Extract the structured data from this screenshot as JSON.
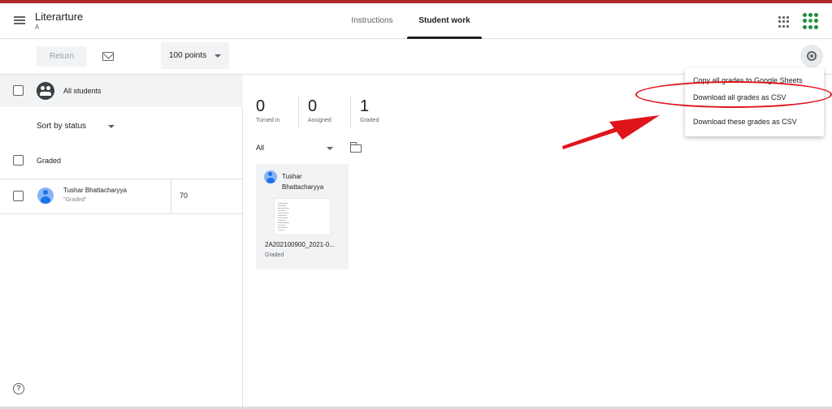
{
  "header": {
    "class_title": "Literarture",
    "class_section": "A",
    "tabs": [
      {
        "label": "Instructions"
      },
      {
        "label": "Student work"
      }
    ]
  },
  "toolbar": {
    "return_label": "Return",
    "points_label": "100 points"
  },
  "left_panel": {
    "all_students_label": "All students",
    "sort_label": "Sort by status",
    "group_label": "Graded",
    "students": [
      {
        "name": "Tushar Bhattacharyya",
        "status": "\"Graded\"",
        "grade": "70"
      }
    ]
  },
  "stats": [
    {
      "number": "0",
      "label": "Turned in"
    },
    {
      "number": "0",
      "label": "Assigned"
    },
    {
      "number": "1",
      "label": "Graded"
    }
  ],
  "filter": {
    "label": "All"
  },
  "work_card": {
    "name_line1": "Tushar",
    "name_line2": "Bhattacharyya",
    "filename": "2A202100900_2021-0...",
    "status": "Graded"
  },
  "menu": {
    "items": [
      {
        "label": "Copy all grades to Google Sheets"
      },
      {
        "label": "Download all grades as CSV"
      },
      {
        "label": "Download these grades as CSV"
      }
    ]
  },
  "colors": {
    "annotation": "#e0141b",
    "stripe": "#b0282a",
    "avatar": "#1a73e8"
  }
}
